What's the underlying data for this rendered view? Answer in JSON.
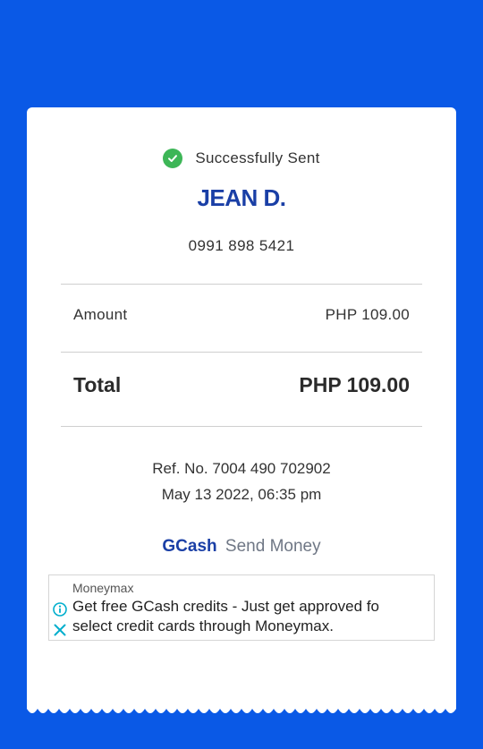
{
  "status": {
    "text": "Successfully Sent"
  },
  "recipient": {
    "name": "JEAN D.",
    "phone": "0991 898 5421"
  },
  "amount": {
    "label": "Amount",
    "value": "PHP 109.00"
  },
  "total": {
    "label": "Total",
    "value": "PHP 109.00"
  },
  "reference": {
    "ref_no": "Ref. No. 7004 490 702902",
    "datetime": "May 13 2022, 06:35 pm"
  },
  "brand": {
    "name": "GCash",
    "service": "Send Money"
  },
  "ad": {
    "sponsor": "Moneymax",
    "line1": "Get free GCash credits - Just get approved fo",
    "line2": "select credit cards through Moneymax."
  },
  "colors": {
    "background": "#0a59e6",
    "brand_blue": "#1a3fa6",
    "success_green": "#3db657",
    "ad_icon": "#00aecd"
  }
}
